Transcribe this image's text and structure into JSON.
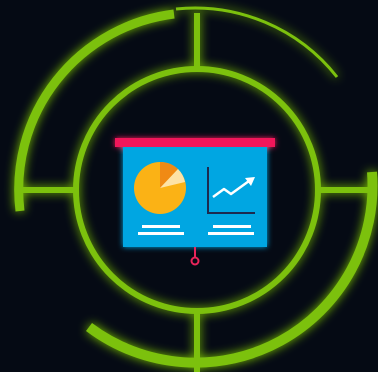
{
  "palette": {
    "background": "#050a14",
    "ring_green": "#7bc110",
    "glow_green": "#8fd11a",
    "board_blue": "#00a6e2",
    "board_rail": "#f2185a",
    "pie_orange": "#fbb215",
    "pie_light": "#fde2a6",
    "pie_dark": "#f08a14",
    "axis_navy": "#1c2a4f",
    "line_white": "#ffffff",
    "stand_pink": "#e8245a"
  },
  "illustration": {
    "icons": [
      "presentation-board-icon",
      "pie-chart-icon",
      "line-chart-icon",
      "trend-arrow-icon",
      "target-rings-icon"
    ]
  }
}
